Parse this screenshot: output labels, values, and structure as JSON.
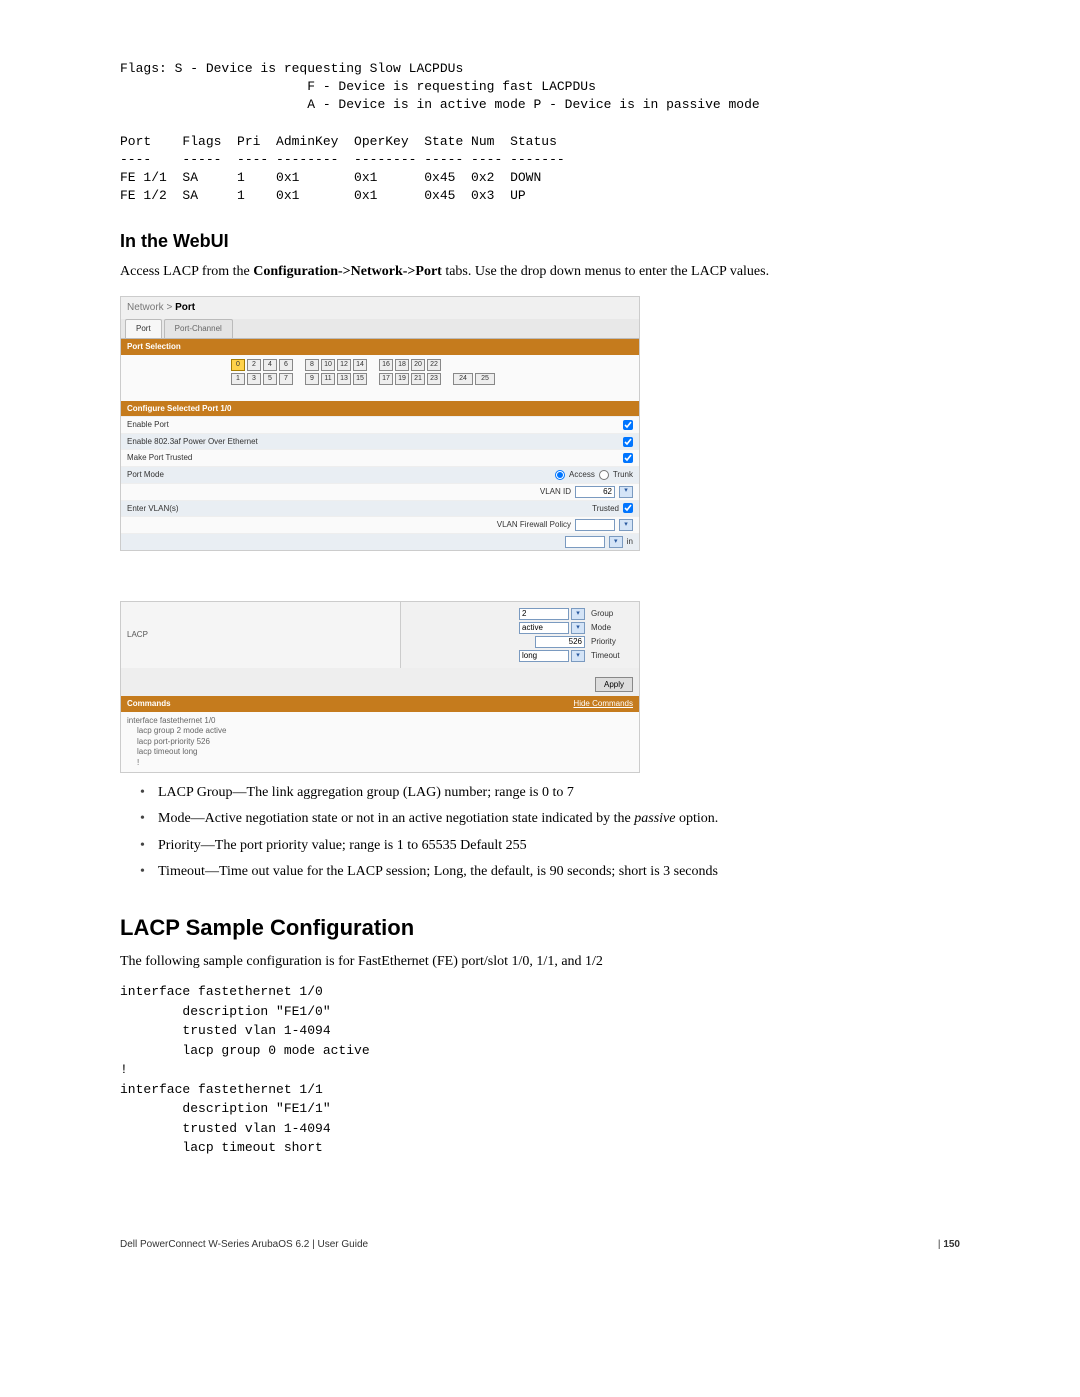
{
  "top_output": "Flags: S - Device is requesting Slow LACPDUs\n                        F - Device is requesting fast LACPDUs\n                        A - Device is in active mode P - Device is in passive mode\n\nPort    Flags  Pri  AdminKey  OperKey  State Num  Status\n----    -----  ---- --------  -------- ----- ---- -------\nFE 1/1  SA     1    0x1       0x1      0x45  0x2  DOWN\nFE 1/2  SA     1    0x1       0x1      0x45  0x3  UP",
  "webui_heading": "In the WebUI",
  "webui_intro_parts": {
    "pre": "Access LACP from the ",
    "path": "Configuration->Network->Port",
    "post": " tabs. Use the drop down menus to enter the LACP values."
  },
  "panel1": {
    "breadcrumb_pre": "Network > ",
    "breadcrumb_strong": "Port",
    "tab_port": "Port",
    "tab_pc": "Port-Channel",
    "port_selection": "Port Selection",
    "ports_top": [
      [
        "0",
        "2",
        "4",
        "6"
      ],
      [
        "8",
        "10",
        "12",
        "14"
      ],
      [
        "16",
        "18",
        "20",
        "22"
      ]
    ],
    "ports_bot": [
      [
        "1",
        "3",
        "5",
        "7"
      ],
      [
        "9",
        "11",
        "13",
        "15"
      ],
      [
        "17",
        "19",
        "21",
        "23"
      ],
      [
        "24",
        "25"
      ]
    ],
    "config_head": "Configure Selected Port 1/0",
    "rows": {
      "enable_port": "Enable Port",
      "poe": "Enable 802.3af Power Over Ethernet",
      "trusted": "Make Port Trusted",
      "port_mode": "Port Mode",
      "access": "Access",
      "trunk": "Trunk",
      "vlan_id": "VLAN ID",
      "vlan_id_val": "62",
      "trusted2": "Trusted",
      "fw_policy": "VLAN Firewall Policy",
      "enter_vlan": "Enter VLAN(s)",
      "in_label": "in"
    }
  },
  "panel2": {
    "lacp_label": "LACP",
    "group": {
      "val": "2",
      "name": "Group"
    },
    "mode": {
      "val": "active",
      "name": "Mode"
    },
    "priority": {
      "val": "526",
      "name": "Priority"
    },
    "timeout": {
      "val": "long",
      "name": "Timeout"
    },
    "apply": "Apply",
    "commands": "Commands",
    "hide": "Hide Commands",
    "cmd_lines": [
      "interface fastethernet 1/0",
      "lacp group 2 mode active",
      "lacp port-priority 526",
      "lacp timeout long",
      "!"
    ]
  },
  "bullets": {
    "b1_pre": "LACP Group—The link aggregation group (LAG) number; range is 0 to 7",
    "b2_pre": "Mode—Active negotiation state or not in an active negotiation state indicated by the ",
    "b2_em": "passive",
    "b2_post": " option.",
    "b3": "Priority—The port priority value; range is 1 to 65535 Default 255",
    "b4": "Timeout—Time out value for the LACP session; Long, the default, is 90 seconds; short is 3 seconds"
  },
  "sample_heading": "LACP Sample Configuration",
  "sample_intro": "The following sample configuration is for FastEthernet (FE) port/slot 1/0, 1/1, and 1/2",
  "sample_code": "interface fastethernet 1/0\n        description \"FE1/0\"\n        trusted vlan 1-4094\n        lacp group 0 mode active\n!\ninterface fastethernet 1/1\n        description \"FE1/1\"\n        trusted vlan 1-4094\n        lacp timeout short",
  "footer_left": "Dell PowerConnect W-Series ArubaOS 6.2 | User Guide",
  "footer_right_prefix": "| ",
  "footer_right_page": "150"
}
